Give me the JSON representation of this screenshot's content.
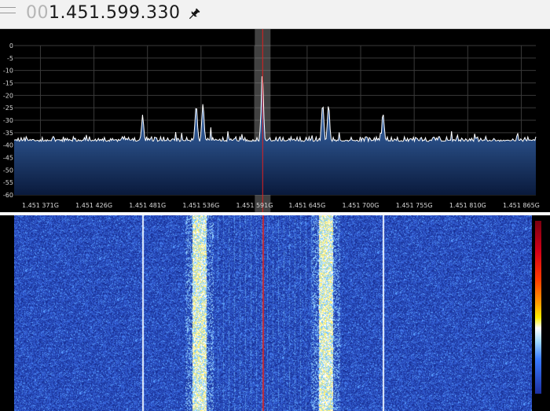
{
  "frequency": {
    "leading": "00",
    "value": "1.451.599.330"
  },
  "icons": {
    "menu": "hamburger-menu-icon",
    "pin": "pushpin-icon"
  },
  "colors": {
    "trace": "#ffffff",
    "fill_top": "#4a86d6",
    "fill_bottom": "#0a1a3c",
    "center_marker": "#e02020",
    "waterfall_bg": "#1d2fa8",
    "grid": "#3a3a3a"
  },
  "chart_data": {
    "type": "line",
    "x_unit": "GHz",
    "y_unit": "dB",
    "ylim": [
      -60,
      0
    ],
    "xlim": [
      1.451344,
      1.45188
    ],
    "grid": true,
    "yticks": [
      0,
      -5,
      -10,
      -15,
      -20,
      -25,
      -30,
      -35,
      -40,
      -45,
      -50,
      -55,
      -60
    ],
    "xticks": [
      {
        "value": 1.451371,
        "label": "1.451 371G"
      },
      {
        "value": 1.451426,
        "label": "1.451 426G"
      },
      {
        "value": 1.451481,
        "label": "1.451 481G"
      },
      {
        "value": 1.451536,
        "label": "1.451 536G"
      },
      {
        "value": 1.451591,
        "label": "1.451 591G"
      },
      {
        "value": 1.451645,
        "label": "1.451 645G"
      },
      {
        "value": 1.4517,
        "label": "1.451 700G"
      },
      {
        "value": 1.451755,
        "label": "1.451 755G"
      },
      {
        "value": 1.45181,
        "label": "1.451 810G"
      },
      {
        "value": 1.451865,
        "label": "1.451 865G"
      }
    ],
    "noise_floor": -38.5,
    "peaks": [
      {
        "x": 1.451476,
        "y": -28
      },
      {
        "x": 1.451531,
        "y": -24
      },
      {
        "x": 1.451538,
        "y": -23
      },
      {
        "x": 1.451599,
        "y": -11
      },
      {
        "x": 1.451661,
        "y": -23
      },
      {
        "x": 1.451667,
        "y": -24
      },
      {
        "x": 1.451723,
        "y": -27
      }
    ],
    "center_frequency": 1.45159933,
    "waterfall_lines": [
      1.451476,
      1.451723
    ],
    "waterfall_bands": [
      1.451534,
      1.451664
    ]
  }
}
